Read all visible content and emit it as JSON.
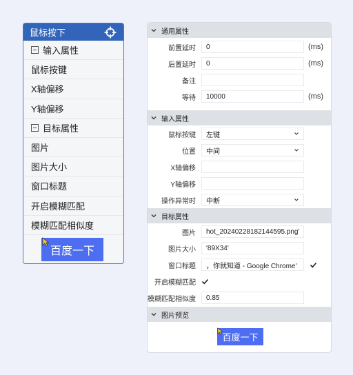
{
  "node": {
    "title": "鼠标按下",
    "rows": [
      {
        "label": "输入属性",
        "collapsible": true
      },
      {
        "label": "鼠标按键",
        "collapsible": false
      },
      {
        "label": "X轴偏移",
        "collapsible": false
      },
      {
        "label": "Y轴偏移",
        "collapsible": false
      },
      {
        "label": "目标属性",
        "collapsible": true
      },
      {
        "label": "图片",
        "collapsible": false
      },
      {
        "label": "图片大小",
        "collapsible": false
      },
      {
        "label": "窗口标题",
        "collapsible": false
      },
      {
        "label": "开启模糊匹配",
        "collapsible": false
      },
      {
        "label": "模糊匹配相似度",
        "collapsible": false
      }
    ],
    "preview_text": "百度一下"
  },
  "panel": {
    "general": {
      "title": "通用属性",
      "delay_before_label": "前置延时",
      "delay_before_value": "0",
      "delay_before_unit": "(ms)",
      "delay_after_label": "后置延时",
      "delay_after_value": "0",
      "delay_after_unit": "(ms)",
      "note_label": "备注",
      "note_value": "",
      "wait_label": "等待",
      "wait_value": "10000",
      "wait_unit": "(ms)"
    },
    "input": {
      "title": "输入属性",
      "button_label": "鼠标按键",
      "button_value": "左键",
      "position_label": "位置",
      "position_value": "中间",
      "x_offset_label": "X轴偏移",
      "x_offset_value": "",
      "y_offset_label": "Y轴偏移",
      "y_offset_value": "",
      "on_error_label": "操作异常时",
      "on_error_value": "中断"
    },
    "target": {
      "title": "目标属性",
      "image_label": "图片",
      "image_value": "hot_20240228182144595.png'",
      "size_label": "图片大小",
      "size_value": "'89X34'",
      "window_label": "窗口标题",
      "window_value": "，你就知道 - Google Chrome'",
      "fuzzy_label": "开启模糊匹配",
      "similarity_label": "模糊匹配相似度",
      "similarity_value": "0.85"
    },
    "preview": {
      "title": "图片预览",
      "button_text": "百度一下"
    }
  },
  "colors": {
    "accent": "#3264b9",
    "preview_blue": "#4e6ef2",
    "background": "#eef0fa"
  }
}
